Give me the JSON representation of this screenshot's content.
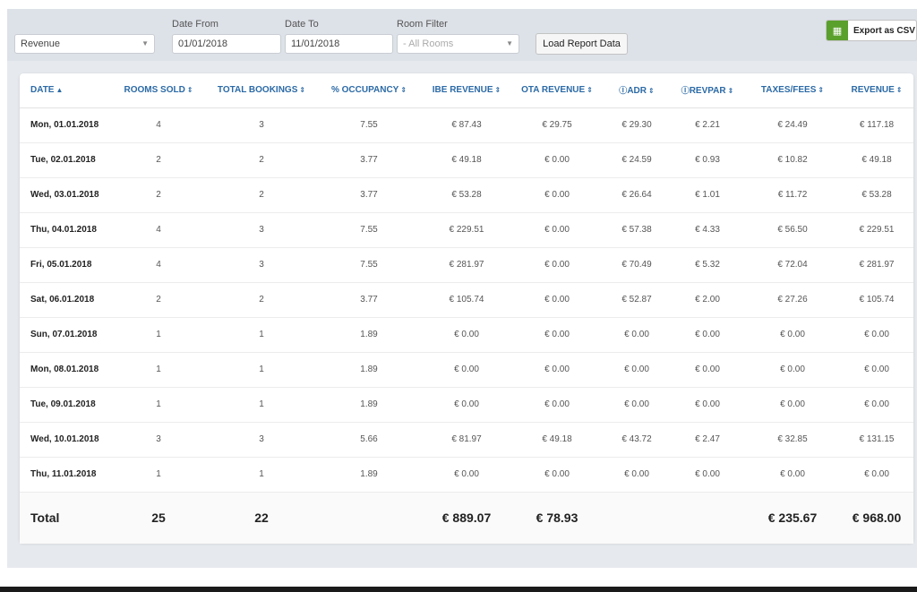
{
  "filters": {
    "report_type": "Revenue",
    "date_from_label": "Date From",
    "date_from_value": "01/01/2018",
    "date_to_label": "Date To",
    "date_to_value": "11/01/2018",
    "room_filter_label": "Room Filter",
    "room_filter_value": "- All Rooms",
    "load_button": "Load Report Data",
    "export_button": "Export as CSV"
  },
  "table": {
    "headers": [
      "DATE",
      "ROOMS SOLD",
      "TOTAL BOOKINGS",
      "% OCCUPANCY",
      "IBE REVENUE",
      "OTA REVENUE",
      "ADR",
      "REVPAR",
      "TAXES/FEES",
      "REVENUE"
    ],
    "rows": [
      [
        "Mon, 01.01.2018",
        "4",
        "3",
        "7.55",
        "€ 87.43",
        "€ 29.75",
        "€ 29.30",
        "€ 2.21",
        "€ 24.49",
        "€ 117.18"
      ],
      [
        "Tue, 02.01.2018",
        "2",
        "2",
        "3.77",
        "€ 49.18",
        "€ 0.00",
        "€ 24.59",
        "€ 0.93",
        "€ 10.82",
        "€ 49.18"
      ],
      [
        "Wed, 03.01.2018",
        "2",
        "2",
        "3.77",
        "€ 53.28",
        "€ 0.00",
        "€ 26.64",
        "€ 1.01",
        "€ 11.72",
        "€ 53.28"
      ],
      [
        "Thu, 04.01.2018",
        "4",
        "3",
        "7.55",
        "€ 229.51",
        "€ 0.00",
        "€ 57.38",
        "€ 4.33",
        "€ 56.50",
        "€ 229.51"
      ],
      [
        "Fri, 05.01.2018",
        "4",
        "3",
        "7.55",
        "€ 281.97",
        "€ 0.00",
        "€ 70.49",
        "€ 5.32",
        "€ 72.04",
        "€ 281.97"
      ],
      [
        "Sat, 06.01.2018",
        "2",
        "2",
        "3.77",
        "€ 105.74",
        "€ 0.00",
        "€ 52.87",
        "€ 2.00",
        "€ 27.26",
        "€ 105.74"
      ],
      [
        "Sun, 07.01.2018",
        "1",
        "1",
        "1.89",
        "€ 0.00",
        "€ 0.00",
        "€ 0.00",
        "€ 0.00",
        "€ 0.00",
        "€ 0.00"
      ],
      [
        "Mon, 08.01.2018",
        "1",
        "1",
        "1.89",
        "€ 0.00",
        "€ 0.00",
        "€ 0.00",
        "€ 0.00",
        "€ 0.00",
        "€ 0.00"
      ],
      [
        "Tue, 09.01.2018",
        "1",
        "1",
        "1.89",
        "€ 0.00",
        "€ 0.00",
        "€ 0.00",
        "€ 0.00",
        "€ 0.00",
        "€ 0.00"
      ],
      [
        "Wed, 10.01.2018",
        "3",
        "3",
        "5.66",
        "€ 81.97",
        "€ 49.18",
        "€ 43.72",
        "€ 2.47",
        "€ 32.85",
        "€ 131.15"
      ],
      [
        "Thu, 11.01.2018",
        "1",
        "1",
        "1.89",
        "€ 0.00",
        "€ 0.00",
        "€ 0.00",
        "€ 0.00",
        "€ 0.00",
        "€ 0.00"
      ]
    ],
    "total": [
      "Total",
      "25",
      "22",
      "",
      "€ 889.07",
      "€ 78.93",
      "",
      "",
      "€ 235.67",
      "€ 968.00"
    ]
  },
  "colors": {
    "header_text": "#2b6aa6",
    "export_icon": "#5aa02c"
  },
  "icons": {
    "export": "spreadsheet-icon",
    "help": "question-circle-icon",
    "sort": "sort-arrow-icon"
  }
}
